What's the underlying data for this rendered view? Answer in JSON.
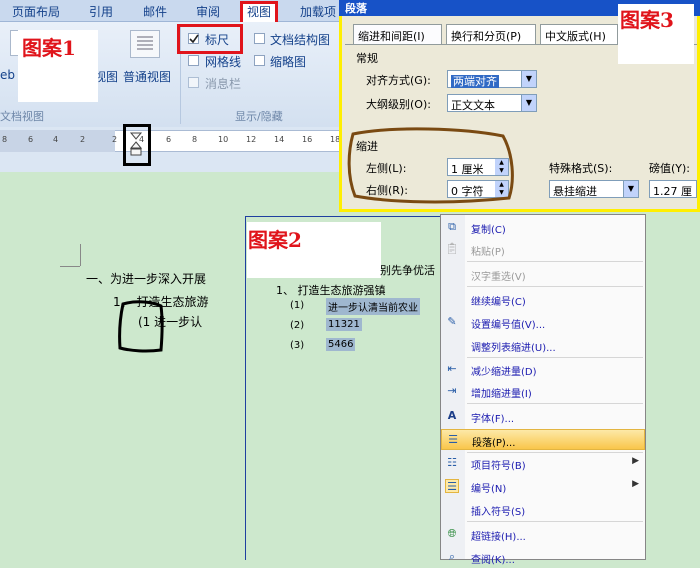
{
  "ribbon": {
    "tabs": [
      "页面布局",
      "引用",
      "邮件",
      "审阅",
      "视图",
      "加载项"
    ],
    "view_buttons": {
      "web": "eb",
      "outline": "视图",
      "normal": "普通视图"
    },
    "show_hide": {
      "ruler": "标尺",
      "gridlines": "网格线",
      "message_bar": "消息栏",
      "doc_map": "文档结构图",
      "thumbnails": "缩略图"
    },
    "group_doc_views": "文档视图",
    "group_show_hide": "显示/隐藏",
    "ruler_numbers": [
      "8",
      "6",
      "4",
      "2",
      "2",
      "4",
      "6",
      "8",
      "10",
      "12",
      "14",
      "16",
      "18"
    ]
  },
  "annotations": {
    "case1": "图案1",
    "case2": "图案2",
    "case3": "图案3"
  },
  "doc1": {
    "line1": "一、为进一步深入开展",
    "line2": "1、 打造生态旅游",
    "line3": "(1   进一步认"
  },
  "dialog": {
    "title": "段落",
    "tabs": [
      "缩进和间距(I)",
      "换行和分页(P)",
      "中文版式(H)"
    ],
    "general_label": "常规",
    "align_label": "对齐方式(G):",
    "align_value": "两端对齐",
    "outline_label": "大纲级别(O):",
    "outline_value": "正文文本",
    "indent_label": "缩进",
    "left_label": "左侧(L):",
    "left_value": "1 厘米",
    "right_label": "右侧(R):",
    "right_value": "0 字符",
    "special_label": "特殊格式(S):",
    "special_value": "悬挂缩进",
    "by_label": "磅值(Y):",
    "by_value": "1.27 厘"
  },
  "doc2": {
    "heading_tail": "别先争优活",
    "line1": "1、  打造生态旅游强镇",
    "items": [
      {
        "num": "(1)",
        "text": "进一步认清当前农业"
      },
      {
        "num": "(2)",
        "text": "11321"
      },
      {
        "num": "(3)",
        "text": "5466"
      }
    ]
  },
  "context_menu": {
    "items": [
      {
        "label": "复制(C)",
        "icon": "copy-icon",
        "disabled": false
      },
      {
        "label": "粘贴(P)",
        "icon": "paste-icon",
        "disabled": true
      },
      {
        "label": "汉字重选(V)",
        "icon": "",
        "disabled": true
      },
      {
        "label": "继续编号(C)",
        "icon": "",
        "disabled": false
      },
      {
        "label": "设置编号值(V)...",
        "icon": "numbering-value-icon",
        "disabled": false
      },
      {
        "label": "调整列表缩进(U)...",
        "icon": "",
        "disabled": false
      },
      {
        "label": "减少缩进量(D)",
        "icon": "decrease-indent-icon",
        "disabled": false
      },
      {
        "label": "增加缩进量(I)",
        "icon": "increase-indent-icon",
        "disabled": false
      },
      {
        "label": "字体(F)...",
        "icon": "font-icon",
        "disabled": false
      },
      {
        "label": "段落(P)...",
        "icon": "paragraph-icon",
        "disabled": false
      },
      {
        "label": "项目符号(B)",
        "icon": "bullets-icon",
        "disabled": false
      },
      {
        "label": "编号(N)",
        "icon": "numbering-icon",
        "disabled": false
      },
      {
        "label": "插入符号(S)",
        "icon": "",
        "disabled": false
      },
      {
        "label": "超链接(H)...",
        "icon": "hyperlink-icon",
        "disabled": false
      },
      {
        "label": "查阅(K)...",
        "icon": "lookup-icon",
        "disabled": false
      }
    ]
  },
  "colors": {
    "annotation_red": "#e0141b",
    "annotation_brown": "#7a4a12",
    "dialog_border_yellow": "#ffef00",
    "doc_background": "#cde8cd",
    "menu_highlight": "#f9c64b"
  }
}
